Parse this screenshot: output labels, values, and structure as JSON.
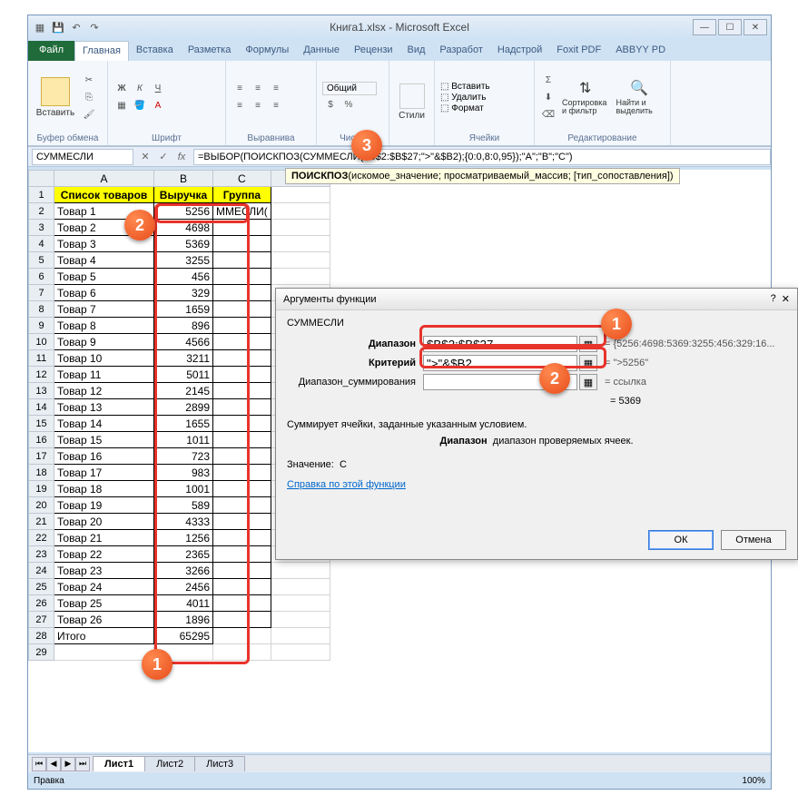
{
  "window": {
    "title": "Книга1.xlsx - Microsoft Excel"
  },
  "tabs": {
    "file": "Файл",
    "list": [
      "Главная",
      "Вставка",
      "Разметка",
      "Формулы",
      "Данные",
      "Рецензи",
      "Вид",
      "Разработ",
      "Надстрой",
      "Foxit PDF",
      "ABBYY PD"
    ],
    "active": 0
  },
  "ribbon_groups": {
    "clipboard": {
      "paste": "Вставить",
      "label": "Буфер обмена"
    },
    "font": {
      "label": "Шрифт"
    },
    "align": {
      "label": "Выравнива"
    },
    "number": {
      "format": "Общий",
      "label": "Число"
    },
    "styles": {
      "btn": "Стили",
      "label": ""
    },
    "cells": {
      "insert": "Вставить",
      "delete": "Удалить",
      "format": "Формат",
      "label": "Ячейки"
    },
    "editing": {
      "sort": "Сортировка и фильтр",
      "find": "Найти и выделить",
      "label": "Редактирование"
    }
  },
  "name_box": "СУММЕСЛИ",
  "formula": "=ВЫБОР(ПОИСКПОЗ(СУММЕСЛИ($B$2:$B$27;\">\"&$B2);{0:0,8:0,95});\"A\";\"B\";\"C\")",
  "fx_tooltip": {
    "fn": "ПОИСКПОЗ",
    "sig": "(искомое_значение; просматриваемый_массив; [тип_сопоставления])"
  },
  "headers": {
    "A": "Список товаров",
    "B": "Выручка",
    "C": "Группа"
  },
  "rows": [
    {
      "a": "Товар 1",
      "b": 5256,
      "c": "ММЕСЛИ("
    },
    {
      "a": "Товар 2",
      "b": 4698,
      "c": ""
    },
    {
      "a": "Товар 3",
      "b": 5369,
      "c": ""
    },
    {
      "a": "Товар 4",
      "b": 3255,
      "c": ""
    },
    {
      "a": "Товар 5",
      "b": 456,
      "c": ""
    },
    {
      "a": "Товар 6",
      "b": 329,
      "c": ""
    },
    {
      "a": "Товар 7",
      "b": 1659,
      "c": ""
    },
    {
      "a": "Товар 8",
      "b": 896,
      "c": ""
    },
    {
      "a": "Товар 9",
      "b": 4566,
      "c": ""
    },
    {
      "a": "Товар 10",
      "b": 3211,
      "c": ""
    },
    {
      "a": "Товар 11",
      "b": 5011,
      "c": ""
    },
    {
      "a": "Товар 12",
      "b": 2145,
      "c": ""
    },
    {
      "a": "Товар 13",
      "b": 2899,
      "c": ""
    },
    {
      "a": "Товар 14",
      "b": 1655,
      "c": ""
    },
    {
      "a": "Товар 15",
      "b": 1011,
      "c": ""
    },
    {
      "a": "Товар 16",
      "b": 723,
      "c": ""
    },
    {
      "a": "Товар 17",
      "b": 983,
      "c": ""
    },
    {
      "a": "Товар 18",
      "b": 1001,
      "c": ""
    },
    {
      "a": "Товар 19",
      "b": 589,
      "c": ""
    },
    {
      "a": "Товар 20",
      "b": 4333,
      "c": ""
    },
    {
      "a": "Товар 21",
      "b": 1256,
      "c": ""
    },
    {
      "a": "Товар 22",
      "b": 2365,
      "c": ""
    },
    {
      "a": "Товар 23",
      "b": 3266,
      "c": ""
    },
    {
      "a": "Товар 24",
      "b": 2456,
      "c": ""
    },
    {
      "a": "Товар 25",
      "b": 4011,
      "c": ""
    },
    {
      "a": "Товар 26",
      "b": 1896,
      "c": ""
    }
  ],
  "total": {
    "label": "Итого",
    "value": 65295
  },
  "dialog": {
    "title": "Аргументы функции",
    "func": "СУММЕСЛИ",
    "args": {
      "range_label": "Диапазон",
      "range_val": "$B$2:$B$27",
      "range_res": "= {5256:4698:5369:3255:456:329:16...",
      "crit_label": "Критерий",
      "crit_val": "\">\"&$B2",
      "crit_res": "= \">5256\"",
      "sum_label": "Диапазон_суммирования",
      "sum_val": "",
      "sum_res": "= ссылка"
    },
    "result_eq": "= 5369",
    "desc1": "Суммирует ячейки, заданные указанным условием.",
    "desc2_bold": "Диапазон",
    "desc2_rest": "диапазон проверяемых ячеек.",
    "value_label": "Значение:",
    "value_val": "C",
    "help": "Справка по этой функции",
    "ok": "ОК",
    "cancel": "Отмена"
  },
  "sheets": [
    "Лист1",
    "Лист2",
    "Лист3"
  ],
  "status": {
    "left": "Правка",
    "zoom": "100%"
  },
  "badges": {
    "b1": "1",
    "b2": "2",
    "b3": "3",
    "d1": "1",
    "d2": "2"
  }
}
